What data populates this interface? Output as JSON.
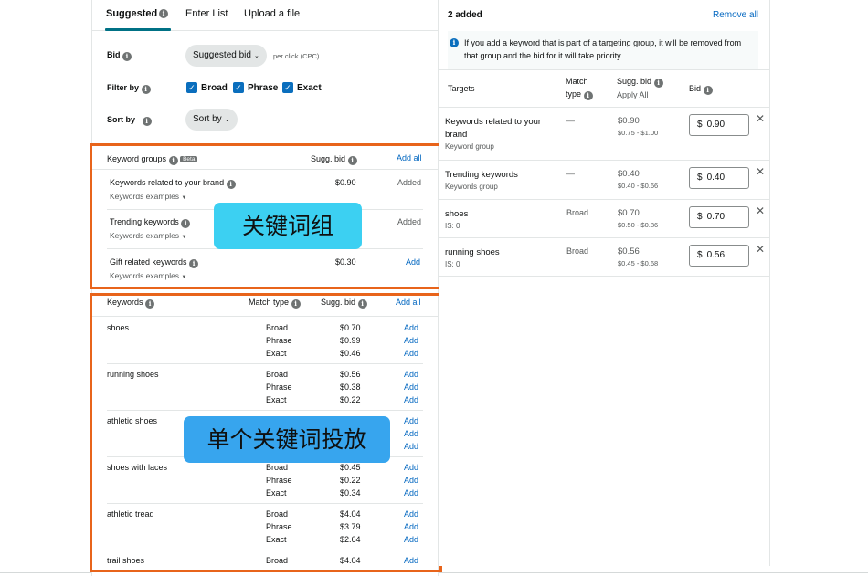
{
  "tabs": [
    "Suggested",
    "Enter List",
    "Upload a file"
  ],
  "bid_row": {
    "label": "Bid",
    "value": "Suggested bid",
    "suffix": "per click (CPC)"
  },
  "filter_row": {
    "label": "Filter by",
    "options": [
      "Broad",
      "Phrase",
      "Exact"
    ]
  },
  "sort_row": {
    "label": "Sort by",
    "value": "Sort by"
  },
  "keyword_groups": {
    "header": "Keyword groups",
    "beta": "Beta",
    "bid_header": "Sugg. bid",
    "add_all": "Add all",
    "items": [
      {
        "name": "Keywords related to your brand",
        "sub": "Keywords examples",
        "bid": "$0.90",
        "action": "Added"
      },
      {
        "name": "Trending keywords",
        "sub": "Keywords examples",
        "bid": "",
        "action": "Added"
      },
      {
        "name": "Gift related keywords",
        "sub": "Keywords examples",
        "bid": "$0.30",
        "action": "Add"
      }
    ]
  },
  "overlay_groups": "关键词组",
  "overlay_keywords": "单个关键词投放",
  "keywords": {
    "header": "Keywords",
    "match_header": "Match type",
    "bid_header": "Sugg. bid",
    "add_all": "Add all",
    "items": [
      {
        "name": "shoes",
        "rows": [
          {
            "mt": "Broad",
            "bid": "$0.70",
            "action": "Add"
          },
          {
            "mt": "Phrase",
            "bid": "$0.99",
            "action": "Add"
          },
          {
            "mt": "Exact",
            "bid": "$0.46",
            "action": "Add"
          }
        ]
      },
      {
        "name": "running shoes",
        "rows": [
          {
            "mt": "Broad",
            "bid": "$0.56",
            "action": "Add"
          },
          {
            "mt": "Phrase",
            "bid": "$0.38",
            "action": "Add"
          },
          {
            "mt": "Exact",
            "bid": "$0.22",
            "action": "Add"
          }
        ]
      },
      {
        "name": "athletic shoes",
        "rows": [
          {
            "mt": "",
            "bid": "",
            "action": "Add"
          },
          {
            "mt": "",
            "bid": "",
            "action": "Add"
          },
          {
            "mt": "",
            "bid": "",
            "action": "Add"
          }
        ]
      },
      {
        "name": "shoes with laces",
        "rows": [
          {
            "mt": "Broad",
            "bid": "$0.45",
            "action": "Add"
          },
          {
            "mt": "Phrase",
            "bid": "$0.22",
            "action": "Add"
          },
          {
            "mt": "Exact",
            "bid": "$0.34",
            "action": "Add"
          }
        ]
      },
      {
        "name": "athletic tread",
        "rows": [
          {
            "mt": "Broad",
            "bid": "$4.04",
            "action": "Add"
          },
          {
            "mt": "Phrase",
            "bid": "$3.79",
            "action": "Add"
          },
          {
            "mt": "Exact",
            "bid": "$2.64",
            "action": "Add"
          }
        ]
      },
      {
        "name": "trail shoes",
        "rows": [
          {
            "mt": "Broad",
            "bid": "$4.04",
            "action": "Add"
          }
        ]
      }
    ]
  },
  "right": {
    "title": "2 added",
    "remove_all": "Remove all",
    "note": "If you add a keyword that is part of a targeting group, it will be removed from that group and the bid for it will take priority.",
    "headers": {
      "targets": "Targets",
      "match_l1": "Match",
      "match_l2": "type",
      "sugg_l1": "Sugg. bid",
      "apply_all": "Apply All",
      "bid": "Bid"
    },
    "targets": [
      {
        "name_l1": "Keywords related to your",
        "name_l2": "brand",
        "sub": "Keyword group",
        "match": "—",
        "sugg": "$0.90",
        "range": "$0.75 - $1.00",
        "bid": "0.90"
      },
      {
        "name_l1": "Trending keywords",
        "name_l2": "",
        "sub": "Keywords group",
        "match": "—",
        "sugg": "$0.40",
        "range": "$0.40 - $0.66",
        "bid": "0.40"
      },
      {
        "name_l1": "shoes",
        "name_l2": "",
        "sub": "IS: 0",
        "match": "Broad",
        "sugg": "$0.70",
        "range": "$0.50 - $0.86",
        "bid": "0.70"
      },
      {
        "name_l1": "running shoes",
        "name_l2": "",
        "sub": "IS: 0",
        "match": "Broad",
        "sugg": "$0.56",
        "range": "$0.45 - $0.68",
        "bid": "0.56"
      }
    ],
    "currency": "$"
  },
  "colors": {
    "accent": "#007185",
    "link": "#0066c0",
    "checkbox": "#0a6ebd",
    "highlight_box": "#e8641b",
    "overlay_groups_bg": "#3cd0f2",
    "overlay_keywords_bg": "#37a5ee"
  }
}
